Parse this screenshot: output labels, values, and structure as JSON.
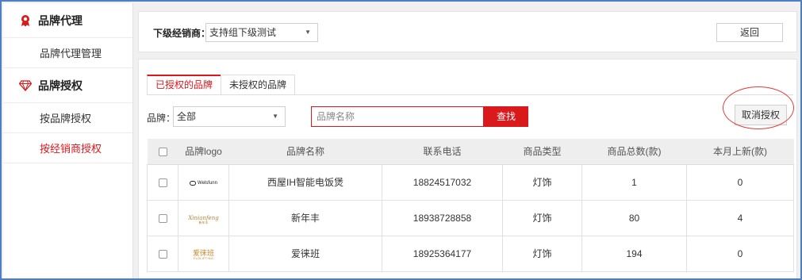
{
  "sidebar": {
    "groups": [
      {
        "label": "品牌代理",
        "icon": "badge-icon",
        "items": [
          {
            "label": "品牌代理管理",
            "active": false
          }
        ]
      },
      {
        "label": "品牌授权",
        "icon": "diamond-icon",
        "items": [
          {
            "label": "按品牌授权",
            "active": false
          },
          {
            "label": "按经销商授权",
            "active": true
          }
        ]
      }
    ]
  },
  "topbar": {
    "dealer_label": "下级经销商：",
    "dealer_value": "支持组下级测试",
    "back_label": "返回"
  },
  "tabs": [
    {
      "label": "已授权的品牌",
      "active": true
    },
    {
      "label": "未授权的品牌",
      "active": false
    }
  ],
  "filter": {
    "brand_label": "品牌：",
    "brand_value": "全部",
    "search_placeholder": "品牌名称",
    "find_label": "查找",
    "cancel_label": "取消授权"
  },
  "table": {
    "columns": [
      "品牌logo",
      "品牌名称",
      "联系电话",
      "商品类型",
      "商品总数(款)",
      "本月上新(款)"
    ],
    "rows": [
      {
        "logo": {
          "text": "Welsfunn"
        },
        "name": "西屋IH智能电饭煲",
        "phone": "18824517032",
        "type": "灯饰",
        "total": "1",
        "new": "0"
      },
      {
        "logo": {
          "text": "Xinianfeng",
          "sub": "新年丰"
        },
        "name": "新年丰",
        "phone": "18938728858",
        "type": "灯饰",
        "total": "80",
        "new": "4"
      },
      {
        "logo": {
          "text": "爱徕班",
          "sub": "FLOLIFTING"
        },
        "name": "爱徕班",
        "phone": "18925364177",
        "type": "灯饰",
        "total": "194",
        "new": "0"
      }
    ]
  },
  "colors": {
    "accent": "#d9191c",
    "frame_border": "#4e7fc0",
    "annotation": "#e23b3b"
  }
}
